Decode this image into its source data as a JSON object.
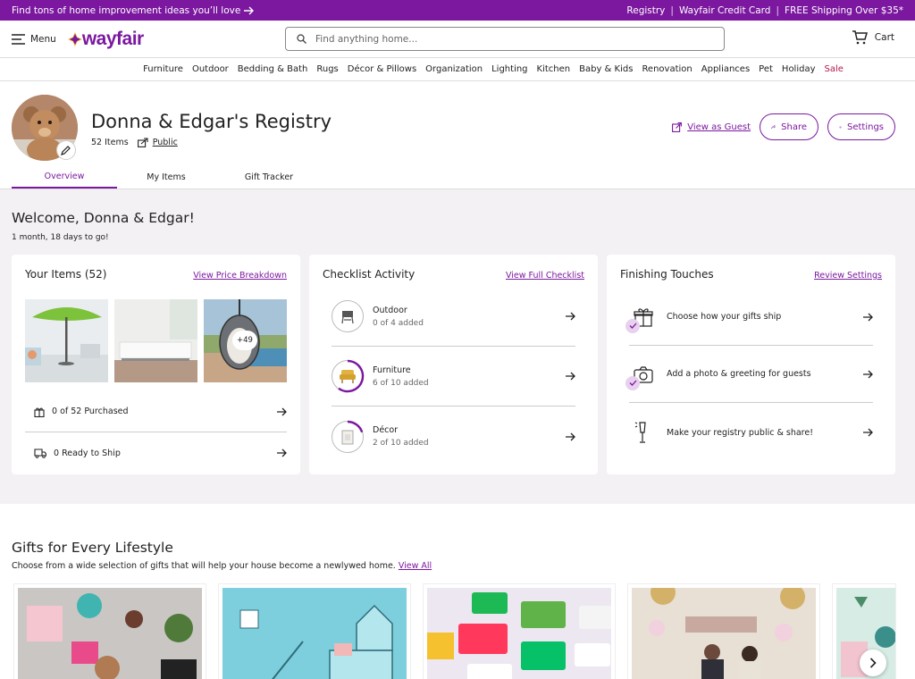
{
  "promo": {
    "left": "Find tons of home improvement ideas you’ll love",
    "registry": "Registry",
    "credit_card": "Wayfair Credit Card",
    "shipping": "FREE Shipping Over $35*"
  },
  "header": {
    "menu": "Menu",
    "logo": "wayfair",
    "search_placeholder": "Find anything home...",
    "cart": "Cart"
  },
  "nav": [
    "Furniture",
    "Outdoor",
    "Bedding & Bath",
    "Rugs",
    "Décor & Pillows",
    "Organization",
    "Lighting",
    "Kitchen",
    "Baby & Kids",
    "Renovation",
    "Appliances",
    "Pet",
    "Holiday",
    "Sale"
  ],
  "registry": {
    "title": "Donna & Edgar's Registry",
    "items_count": "52 Items",
    "visibility": "Public",
    "view_as_guest": "View as Guest",
    "share": "Share",
    "settings": "Settings",
    "tabs": [
      "Overview",
      "My Items",
      "Gift Tracker"
    ]
  },
  "overview": {
    "welcome": "Welcome, Donna & Edgar!",
    "countdown": "1 month, 18 days to go!",
    "your_items": {
      "title": "Your Items (52)",
      "link": "View Price Breakdown",
      "more_badge": "+49",
      "purchased": "0 of 52 Purchased",
      "ready": "0 Ready to Ship"
    },
    "checklist": {
      "title": "Checklist Activity",
      "link": "View Full Checklist",
      "rows": [
        {
          "name": "Outdoor",
          "sub": "0 of 4 added",
          "progress": 0
        },
        {
          "name": "Furniture",
          "sub": "6 of 10 added",
          "progress": 0.6
        },
        {
          "name": "Décor",
          "sub": "2 of 10 added",
          "progress": 0.2
        }
      ]
    },
    "finishing": {
      "title": "Finishing Touches",
      "link": "Review Settings",
      "rows": [
        "Choose how your gifts ship",
        "Add a photo & greeting for guests",
        "Make your registry public & share!"
      ]
    }
  },
  "gifts": {
    "title": "Gifts for Every Lifestyle",
    "subtitle": "Choose from a wide selection of gifts that will help your house become a newlywed home.",
    "view_all": "View All"
  },
  "colors": {
    "brand": "#7b189f",
    "sale": "#b5174b"
  }
}
